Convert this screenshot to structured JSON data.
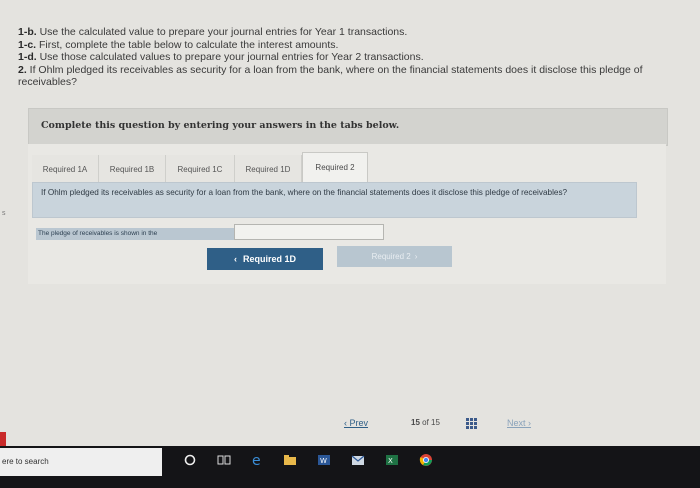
{
  "instructions": [
    {
      "prefix": "1-b.",
      "text": " Use the calculated value to prepare your journal entries for Year 1 transactions."
    },
    {
      "prefix": "1-c.",
      "text": " First, complete the table below to calculate the interest amounts."
    },
    {
      "prefix": "1-d.",
      "text": " Use those calculated values to prepare your journal entries for Year 2 transactions."
    },
    {
      "prefix": "2.",
      "text": " If Ohlm pledged its receivables as security for a loan from the bank, where on the financial statements does it disclose this pledge of receivables?"
    }
  ],
  "panel": {
    "header": "Complete this question by entering your answers in the tabs below."
  },
  "tabs": [
    {
      "label": "Required 1A"
    },
    {
      "label": "Required 1B"
    },
    {
      "label": "Required 1C"
    },
    {
      "label": "Required 1D"
    },
    {
      "label": "Required 2"
    }
  ],
  "question": "If Ohlm pledged its receivables as security for a loan from the bank, where on the financial statements does it disclose this pledge of receivables?",
  "answer": {
    "label": "The pledge of receivables is shown in the",
    "value": ""
  },
  "nav_buttons": {
    "prev": "Required 1D",
    "next": "Required 2"
  },
  "pager": {
    "prev": "Prev",
    "current": "15",
    "of": "of",
    "total": "15",
    "next": "Next"
  },
  "side_mark": "s",
  "taskbar": {
    "search": "ere to search"
  },
  "colors": {
    "accent": "#2f5f87",
    "question_bg": "#c9d4dc",
    "taskbar": "#141417"
  }
}
